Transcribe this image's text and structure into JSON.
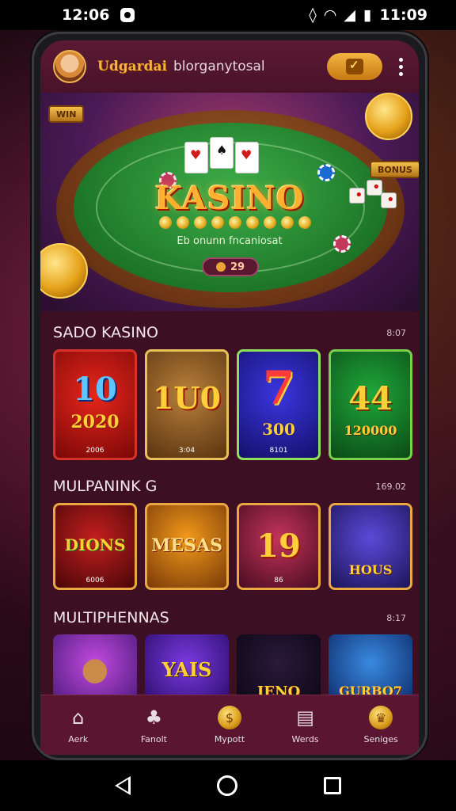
{
  "status_bar": {
    "time_left": "12:06",
    "time_right": "11:09"
  },
  "header": {
    "brand": "Udgardai",
    "subtitle": "blorganytosal"
  },
  "hero": {
    "title": "KASINO",
    "subtitle": "Eb onunn fncaniosat",
    "pill_value": "29",
    "left_ribbon": "WIN",
    "right_ribbon": "BONUS"
  },
  "sections": [
    {
      "title": "SADO KASINO",
      "count": "8:07",
      "tiles": [
        {
          "big": "10",
          "small": "2020",
          "foot": "2006",
          "bg1": "#e8261b",
          "bg2": "#7a0808",
          "border": "#d6322a"
        },
        {
          "big": "1U0",
          "small": "",
          "foot": "3:04",
          "bg1": "#b9803a",
          "bg2": "#5a3410",
          "border": "#e9c15a"
        },
        {
          "big": "7",
          "small": "300",
          "foot": "8101",
          "bg1": "#3b36e0",
          "bg2": "#14106a",
          "border": "#8ee05a"
        },
        {
          "big": "44",
          "small": "120000",
          "foot": "",
          "bg1": "#1fa83a",
          "bg2": "#0b4a16",
          "border": "#7ad04a"
        }
      ]
    },
    {
      "title": "MULPANINK G",
      "count": "169.02",
      "tiles": [
        {
          "big": "DIONS",
          "foot": "6006",
          "bg1": "#c41f1f",
          "bg2": "#4a0608"
        },
        {
          "big": "MESAS",
          "foot": "",
          "bg1": "#f29a1a",
          "bg2": "#7a3a08"
        },
        {
          "big": "19",
          "foot": "86",
          "bg1": "#c4345a",
          "bg2": "#4a0c22"
        },
        {
          "big": "HOUS",
          "foot": "",
          "bg1": "#5a4ad8",
          "bg2": "#1e145a"
        }
      ]
    },
    {
      "title": "MULTIPHENNAS",
      "count": "8:17",
      "tiles": [
        {
          "big": "",
          "bg1": "#c24ae0",
          "bg2": "#4a1a7a"
        },
        {
          "big": "YAIS",
          "bg1": "#7a3ae0",
          "bg2": "#2a0c6a"
        },
        {
          "big": "IENO",
          "bg1": "#2a1a3a",
          "bg2": "#0c0614"
        },
        {
          "big": "GURBO7",
          "bg1": "#3a8ae0",
          "bg2": "#0c2a6a"
        }
      ]
    }
  ],
  "bottom_nav": [
    {
      "label": "Aerk",
      "icon": "home-icon"
    },
    {
      "label": "Fanolt",
      "icon": "cards-icon"
    },
    {
      "label": "Mypott",
      "icon": "coin-icon"
    },
    {
      "label": "Werds",
      "icon": "document-icon"
    },
    {
      "label": "Seniges",
      "icon": "trophy-icon"
    }
  ],
  "colors": {
    "accent": "#f3b441",
    "background": "#3d0f22",
    "nav": "#5a1530"
  }
}
